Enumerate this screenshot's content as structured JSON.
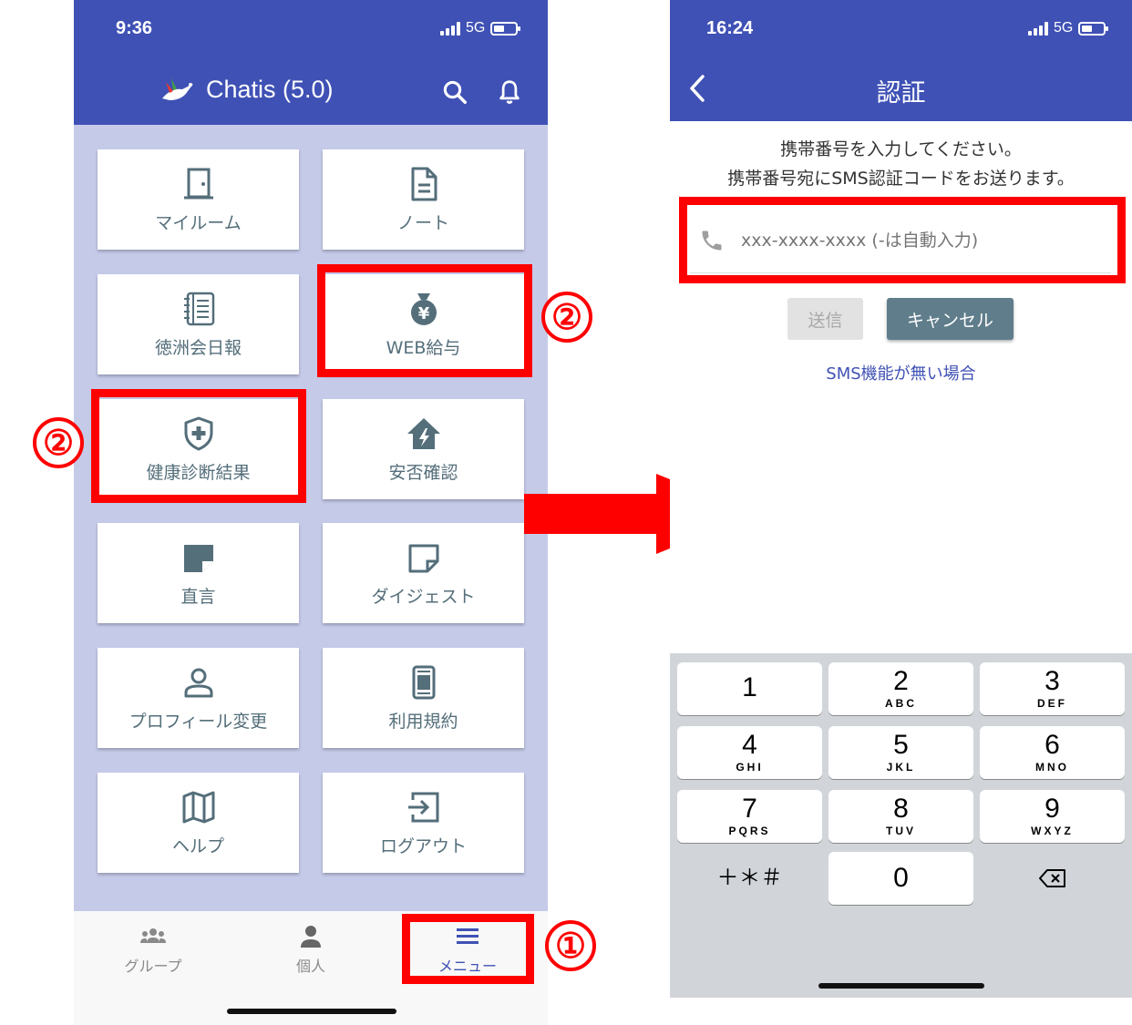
{
  "left_screen": {
    "status": {
      "time": "9:36",
      "network": "5G"
    },
    "header": {
      "title": "Chatis (5.0)"
    },
    "menu_tiles": [
      {
        "label": "マイルーム",
        "icon": "door-icon"
      },
      {
        "label": "ノート",
        "icon": "document-icon"
      },
      {
        "label": "徳洲会日報",
        "icon": "notebook-icon"
      },
      {
        "label": "WEB給与",
        "icon": "money-bag-icon"
      },
      {
        "label": "健康診断結果",
        "icon": "health-shield-icon"
      },
      {
        "label": "安否確認",
        "icon": "safety-house-icon"
      },
      {
        "label": "直言",
        "icon": "note-filled-icon"
      },
      {
        "label": "ダイジェスト",
        "icon": "note-outline-icon"
      },
      {
        "label": "プロフィール変更",
        "icon": "person-icon"
      },
      {
        "label": "利用規約",
        "icon": "terms-icon"
      },
      {
        "label": "ヘルプ",
        "icon": "map-icon"
      },
      {
        "label": "ログアウト",
        "icon": "logout-icon"
      }
    ],
    "bottom_nav": [
      {
        "label": "グループ",
        "icon": "group-icon",
        "active": false
      },
      {
        "label": "個人",
        "icon": "person-icon",
        "active": false
      },
      {
        "label": "メニュー",
        "icon": "menu-icon",
        "active": true
      }
    ]
  },
  "annotations": {
    "step1": "①",
    "step2": "②"
  },
  "right_screen": {
    "status": {
      "time": "16:24",
      "network": "5G"
    },
    "header": {
      "title": "認証"
    },
    "instructions": {
      "line1": "携帯番号を入力してください。",
      "line2": "携帯番号宛にSMS認証コードをお送ります。"
    },
    "phone_input": {
      "placeholder": "xxx-xxxx-xxxx (-は自動入力)",
      "value": ""
    },
    "buttons": {
      "send": "送信",
      "cancel": "キャンセル"
    },
    "sms_link": "SMS機能が無い場合",
    "keypad": [
      {
        "num": "1",
        "letters": ""
      },
      {
        "num": "2",
        "letters": "ABC"
      },
      {
        "num": "3",
        "letters": "DEF"
      },
      {
        "num": "4",
        "letters": "GHI"
      },
      {
        "num": "5",
        "letters": "JKL"
      },
      {
        "num": "6",
        "letters": "MNO"
      },
      {
        "num": "7",
        "letters": "PQRS"
      },
      {
        "num": "8",
        "letters": "TUV"
      },
      {
        "num": "9",
        "letters": "WXYZ"
      },
      {
        "num": "＋＊＃",
        "letters": ""
      },
      {
        "num": "0",
        "letters": ""
      }
    ]
  },
  "colors": {
    "primary": "#3f51b5",
    "menu_bg": "#c5cae9",
    "tile_text": "#546e7a",
    "highlight": "#ff0000"
  }
}
